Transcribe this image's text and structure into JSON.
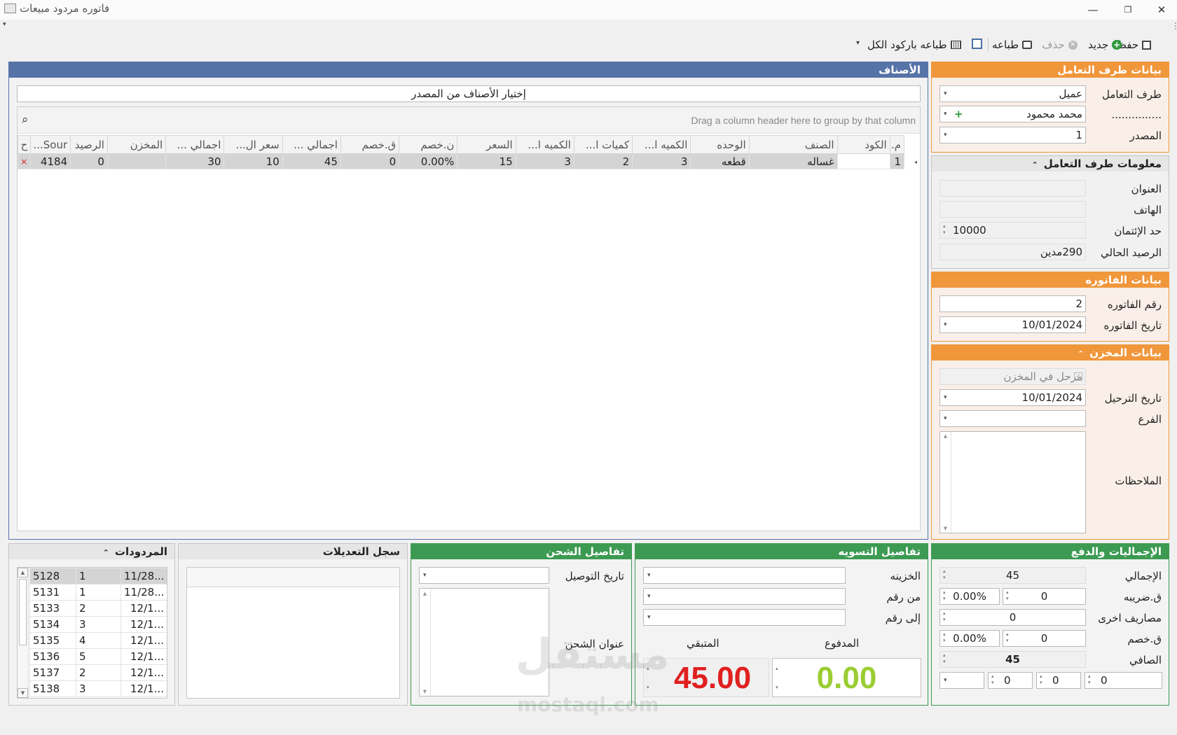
{
  "window": {
    "title": "فاتوره مردود مبيعات",
    "minimize": "—",
    "restore": "❐",
    "close": "✕"
  },
  "toolbar": {
    "save": "حفظ",
    "new": "جديد",
    "delete": "حذف",
    "print": "طباعه",
    "print_barcode_all": "طباعه باركود الكل"
  },
  "counterparty": {
    "header": "بيانات طرف التعامل",
    "type_label": "طرف التعامل",
    "type_value": "عميل",
    "name_label": "...............",
    "name_value": "محمد محمود",
    "source_label": "المصدر",
    "source_value": "1"
  },
  "counterparty_info": {
    "header": "معلومات طرف التعامل",
    "address_label": "العنوان",
    "address_value": "",
    "phone_label": "الهاتف",
    "phone_value": "",
    "credit_label": "حد الإئتمان",
    "credit_value": "10000",
    "balance_label": "الرصيد الحالي",
    "balance_value": "290مدين"
  },
  "invoice": {
    "header": "بيانات الفاتوره",
    "number_label": "رقم الفاتوره",
    "number_value": "2",
    "date_label": "تاريخ الفاتوره",
    "date_value": "10/01/2024"
  },
  "store": {
    "header": "بيانات المخزن",
    "posted_label": "مرحل في المخزن",
    "post_date_label": "تاريخ الترحيل",
    "post_date_value": "10/01/2024",
    "branch_label": "الفرع",
    "branch_value": "",
    "notes_label": "الملاحظات"
  },
  "items": {
    "header": "الأصناف",
    "select_from_source": "إختيار الأصناف من المصدر",
    "group_hint": "Drag a column header here to group by that column",
    "columns": [
      "م.",
      "الكود",
      "الصنف",
      "الوحده",
      "الكميه ا...",
      "كميات ا...",
      "الكميه ا...",
      "السعر",
      "ن.خصم",
      "ق.خصم",
      "اجمالي ...",
      "سعر ال...",
      "اجمالي ...",
      "المخزن",
      "الرصيد",
      "Sour...",
      "ح"
    ],
    "rows": [
      [
        "1",
        "",
        "غساله",
        "قطعه",
        "3",
        "2",
        "3",
        "15",
        "0.00%",
        "0",
        "45",
        "10",
        "30",
        "",
        "0",
        "4184",
        "×"
      ]
    ]
  },
  "totals": {
    "header": "الإجماليات والدفع",
    "total_label": "الإجمالي",
    "total_value": "45",
    "tax_label": "ق.ضريبه",
    "tax_value": "0",
    "tax_pct": "0.00%",
    "other_label": "مصاريف اخرى",
    "other_value": "0",
    "discount_label": "ق.خصم",
    "discount_value": "0",
    "discount_pct": "0.00%",
    "net_label": "الصافي",
    "net_value": "45",
    "bottom_values": [
      "0",
      "0",
      "0",
      ""
    ]
  },
  "settlement": {
    "header": "تفاصيل التسويه",
    "treasury_label": "الخزينه",
    "from_label": "من رقم",
    "to_label": "إلى رقم",
    "paid_label": "المدفوع",
    "paid_value": "0.00",
    "remaining_label": "المتبقي",
    "remaining_value": "45.00"
  },
  "shipping": {
    "header": "تفاصيل الشحن",
    "delivery_date_label": "تاريخ التوصيل",
    "address_label": "عنوان الشحن"
  },
  "changelog": {
    "header": "سجل التعديلات"
  },
  "returns": {
    "header": "المردودات",
    "rows": [
      [
        "5128",
        "1",
        "11/28..."
      ],
      [
        "5131",
        "1",
        "11/28..."
      ],
      [
        "5133",
        "2",
        "12/1..."
      ],
      [
        "5134",
        "3",
        "12/1..."
      ],
      [
        "5135",
        "4",
        "12/1..."
      ],
      [
        "5136",
        "5",
        "12/1..."
      ],
      [
        "5137",
        "2",
        "12/1..."
      ],
      [
        "5138",
        "3",
        "12/1..."
      ]
    ]
  },
  "watermark": {
    "arabic": "مستقل",
    "latin": "mostaql.com"
  },
  "colors": {
    "orange": "#f0963b",
    "blue": "#5673a8",
    "green": "#3c9a52",
    "paid": "#9acd32",
    "remaining": "#e02020"
  }
}
